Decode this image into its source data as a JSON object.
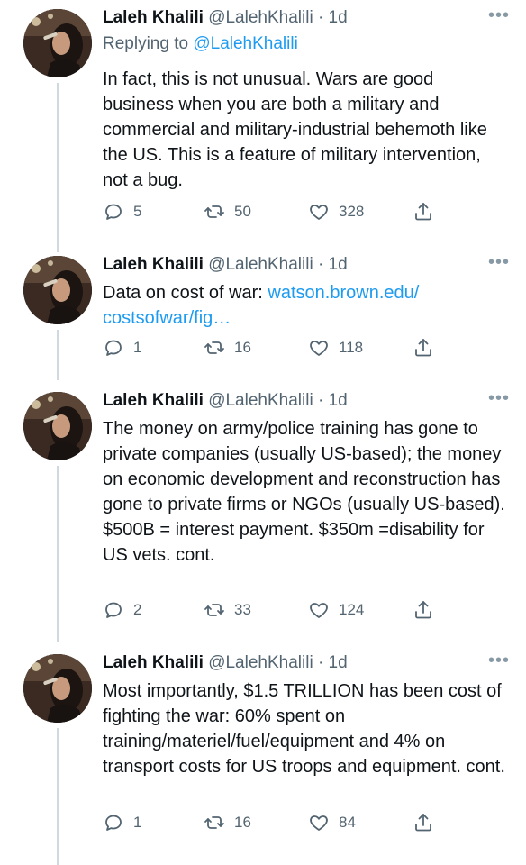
{
  "tweets": [
    {
      "name": "Laleh Khalili",
      "handle": "@LalehKhalili",
      "time": "· 1d",
      "replying_label": "Replying to",
      "replying_to": "@LalehKhalili",
      "text": "In fact, this is not unusual. Wars are good business when you are both a military and commercial and military-industrial behemoth like the US. This is a feature of military intervention, not a bug.",
      "replies": "5",
      "retweets": "50",
      "likes": "328"
    },
    {
      "name": "Laleh Khalili",
      "handle": "@LalehKhalili",
      "time": "· 1d",
      "text_prefix": "Data on cost of war: ",
      "link_line1": "watson.brown.edu/",
      "link_line2": "costsofwar/fig…",
      "replies": "1",
      "retweets": "16",
      "likes": "118"
    },
    {
      "name": "Laleh Khalili",
      "handle": "@LalehKhalili",
      "time": "· 1d",
      "text": "The money on army/police training has gone to private companies (usually US-based); the money on economic development and reconstruction has gone to private firms or NGOs (usually US-based). $500B = interest payment. $350m =disability for US vets. cont.",
      "replies": "2",
      "retweets": "33",
      "likes": "124"
    },
    {
      "name": "Laleh Khalili",
      "handle": "@LalehKhalili",
      "time": "· 1d",
      "text": "Most importantly, $1.5 TRILLION has been cost of fighting the war: 60% spent on training/materiel/fuel/equipment and 4% on transport costs for US troops and equipment. cont.",
      "replies": "1",
      "retweets": "16",
      "likes": "84"
    }
  ],
  "icons": {
    "more": "more-dots-icon",
    "reply": "reply-bubble-icon",
    "retweet": "retweet-icon",
    "like": "heart-icon",
    "share": "share-icon"
  },
  "colors": {
    "link": "#1d9bf0",
    "secondary": "#536471",
    "thread_line": "#cfd9de"
  }
}
